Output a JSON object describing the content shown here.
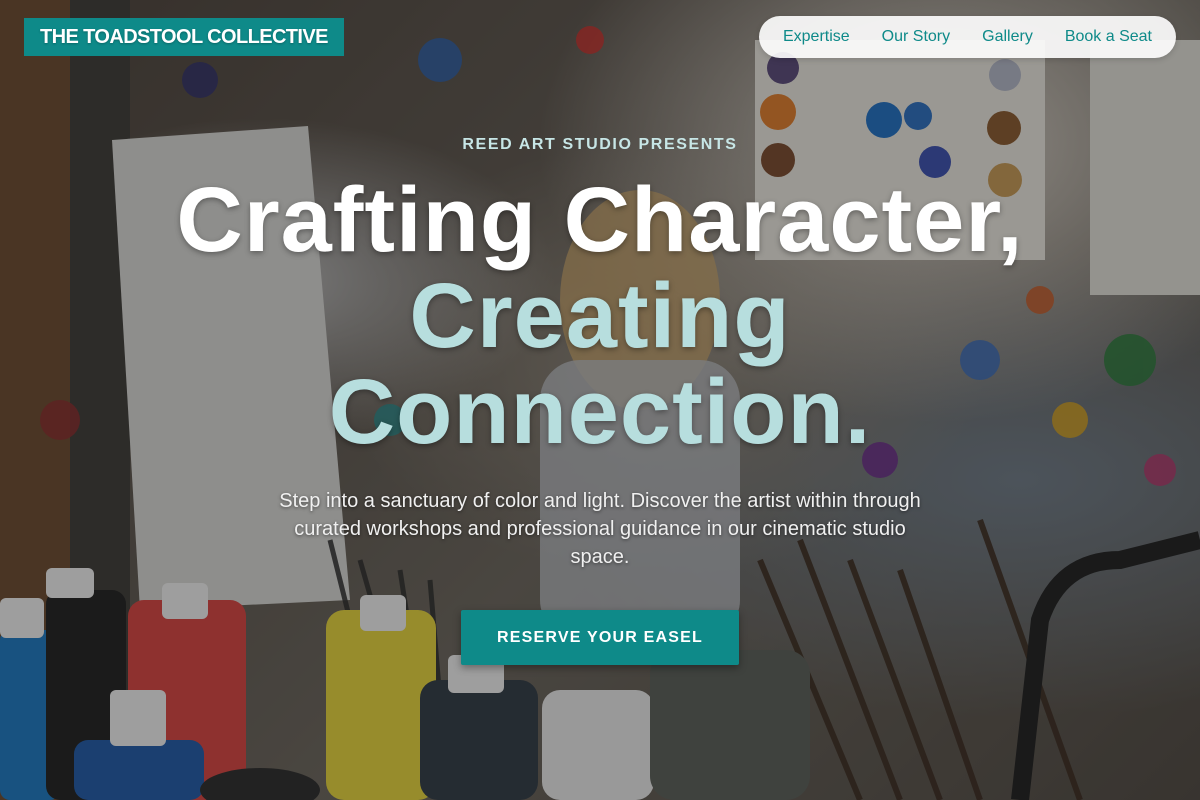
{
  "brand": {
    "name": "THE TOADSTOOL COLLECTIVE"
  },
  "nav": {
    "items": [
      {
        "label": "Expertise"
      },
      {
        "label": "Our Story"
      },
      {
        "label": "Gallery"
      },
      {
        "label": "Book a Seat"
      }
    ]
  },
  "hero": {
    "kicker": "REED ART STUDIO PRESENTS",
    "headline_line1": "Crafting Character,",
    "headline_line2": "Creating",
    "headline_line3": "Connection.",
    "lede": "Step into a sanctuary of color and light. Discover the artist within through curated workshops and professional guidance in our cinematic studio space.",
    "cta_label": "RESERVE YOUR EASEL"
  },
  "colors": {
    "accent": "#0e8a89",
    "headline_primary": "#ffffff",
    "headline_secondary": "#b7dede",
    "kicker": "#c7e6e6"
  },
  "background": {
    "icon": "painting-studio-photo"
  }
}
